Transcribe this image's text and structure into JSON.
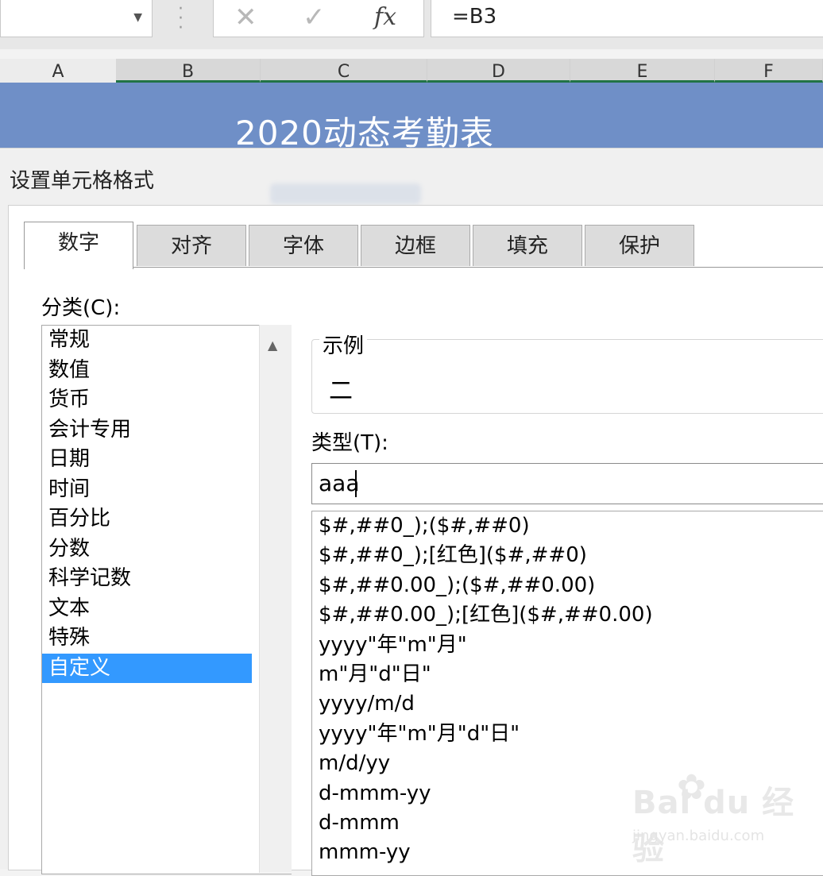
{
  "formula_bar": {
    "cancel_icon": "✕",
    "enter_icon": "✓",
    "fx_label": "fx",
    "formula": "=B3"
  },
  "columns": [
    "A",
    "B",
    "C",
    "D",
    "E",
    "F"
  ],
  "sheet": {
    "title": "2020动态考勤表"
  },
  "dialog": {
    "title": "设置单元格格式",
    "tabs": [
      "数字",
      "对齐",
      "字体",
      "边框",
      "填充",
      "保护"
    ],
    "active_tab": "数字",
    "category_label": "分类(C):",
    "categories": [
      "常规",
      "数值",
      "货币",
      "会计专用",
      "日期",
      "时间",
      "百分比",
      "分数",
      "科学记数",
      "文本",
      "特殊",
      "自定义"
    ],
    "selected_category": "自定义",
    "sample_label": "示例",
    "sample_value": "二",
    "type_label": "类型(T):",
    "type_value": "aaa",
    "formats": [
      "$#,##0_);($#,##0)",
      "$#,##0_);[红色]($#,##0)",
      "$#,##0.00_);($#,##0.00)",
      "$#,##0.00_);[红色]($#,##0.00)",
      "yyyy\"年\"m\"月\"",
      "m\"月\"d\"日\"",
      "yyyy/m/d",
      "yyyy\"年\"m\"月\"d\"日\"",
      "m/d/yy",
      "d-mmm-yy",
      "d-mmm",
      "mmm-yy"
    ]
  },
  "watermark": {
    "logo": "Bai du 经验",
    "url": "jingyan.baidu.com"
  },
  "colors": {
    "selection": "#3399ff",
    "title_bar": "#6f8fc7",
    "column_accent": "#217346"
  }
}
